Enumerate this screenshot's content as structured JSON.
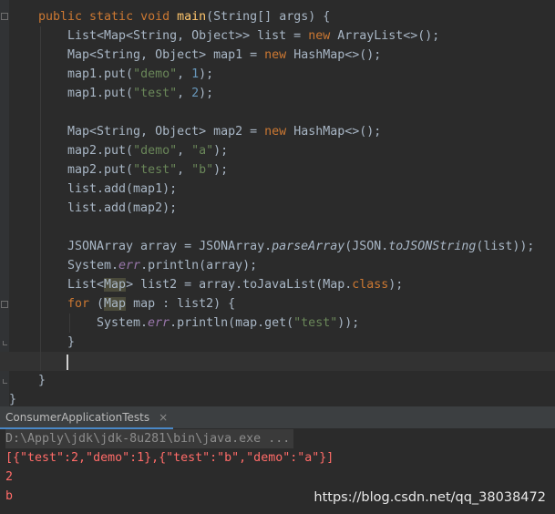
{
  "editor": {
    "lines": [
      {
        "indent": 42,
        "tokens": [
          {
            "c": "kw",
            "t": "public static void "
          },
          {
            "c": "fn",
            "t": "main"
          },
          {
            "c": "",
            "t": "(String[] args) {"
          }
        ]
      },
      {
        "indent": 74,
        "tokens": [
          {
            "c": "",
            "t": "List<Map<String, Object>> list = "
          },
          {
            "c": "kw",
            "t": "new "
          },
          {
            "c": "",
            "t": "ArrayList<>();"
          }
        ]
      },
      {
        "indent": 74,
        "tokens": [
          {
            "c": "",
            "t": "Map<String, Object> map1 = "
          },
          {
            "c": "kw",
            "t": "new "
          },
          {
            "c": "",
            "t": "HashMap<>();"
          }
        ]
      },
      {
        "indent": 74,
        "tokens": [
          {
            "c": "",
            "t": "map1.put("
          },
          {
            "c": "str",
            "t": "\"demo\""
          },
          {
            "c": "",
            "t": ", "
          },
          {
            "c": "num",
            "t": "1"
          },
          {
            "c": "",
            "t": ");"
          }
        ]
      },
      {
        "indent": 74,
        "tokens": [
          {
            "c": "",
            "t": "map1.put("
          },
          {
            "c": "str",
            "t": "\"test\""
          },
          {
            "c": "",
            "t": ", "
          },
          {
            "c": "num",
            "t": "2"
          },
          {
            "c": "",
            "t": ");"
          }
        ]
      },
      {
        "indent": 74,
        "tokens": []
      },
      {
        "indent": 74,
        "tokens": [
          {
            "c": "",
            "t": "Map<String, Object> map2 = "
          },
          {
            "c": "kw",
            "t": "new "
          },
          {
            "c": "",
            "t": "HashMap<>();"
          }
        ]
      },
      {
        "indent": 74,
        "tokens": [
          {
            "c": "",
            "t": "map2.put("
          },
          {
            "c": "str",
            "t": "\"demo\""
          },
          {
            "c": "",
            "t": ", "
          },
          {
            "c": "str",
            "t": "\"a\""
          },
          {
            "c": "",
            "t": ");"
          }
        ]
      },
      {
        "indent": 74,
        "tokens": [
          {
            "c": "",
            "t": "map2.put("
          },
          {
            "c": "str",
            "t": "\"test\""
          },
          {
            "c": "",
            "t": ", "
          },
          {
            "c": "str",
            "t": "\"b\""
          },
          {
            "c": "",
            "t": ");"
          }
        ]
      },
      {
        "indent": 74,
        "tokens": [
          {
            "c": "",
            "t": "list.add(map1);"
          }
        ]
      },
      {
        "indent": 74,
        "tokens": [
          {
            "c": "",
            "t": "list.add(map2);"
          }
        ]
      },
      {
        "indent": 74,
        "tokens": []
      },
      {
        "indent": 74,
        "tokens": [
          {
            "c": "",
            "t": "JSONArray array = JSONArray."
          },
          {
            "c": "it",
            "t": "parseArray"
          },
          {
            "c": "",
            "t": "(JSON."
          },
          {
            "c": "it",
            "t": "toJSONString"
          },
          {
            "c": "",
            "t": "(list));"
          }
        ]
      },
      {
        "indent": 74,
        "tokens": [
          {
            "c": "",
            "t": "System."
          },
          {
            "c": "field",
            "t": "err"
          },
          {
            "c": "",
            "t": ".println(array);"
          }
        ]
      },
      {
        "indent": 74,
        "tokens": [
          {
            "c": "",
            "t": "List<"
          },
          {
            "c": "hl",
            "t": "Map"
          },
          {
            "c": "",
            "t": "> list2 = array.toJavaList(Map."
          },
          {
            "c": "kw",
            "t": "class"
          },
          {
            "c": "",
            "t": ");"
          }
        ]
      },
      {
        "indent": 74,
        "tokens": [
          {
            "c": "kw",
            "t": "for "
          },
          {
            "c": "",
            "t": "("
          },
          {
            "c": "hl",
            "t": "Map"
          },
          {
            "c": "",
            "t": " map : list2) {"
          }
        ]
      },
      {
        "indent": 106,
        "tokens": [
          {
            "c": "",
            "t": "System."
          },
          {
            "c": "field",
            "t": "err"
          },
          {
            "c": "",
            "t": ".println(map.get("
          },
          {
            "c": "str",
            "t": "\"test\""
          },
          {
            "c": "",
            "t": "));"
          }
        ]
      },
      {
        "indent": 74,
        "tokens": [
          {
            "c": "",
            "t": "}"
          }
        ]
      },
      {
        "indent": 74,
        "tokens": [],
        "current": true
      },
      {
        "indent": 42,
        "tokens": [
          {
            "c": "",
            "t": "}"
          }
        ]
      },
      {
        "indent": 10,
        "tokens": [
          {
            "c": "",
            "t": "}"
          }
        ]
      }
    ]
  },
  "run_panel": {
    "tab_label": "ConsumerApplicationTests",
    "tab_close": "×",
    "command": "D:\\Apply\\jdk\\jdk-8u281\\bin\\java.exe ...",
    "output": [
      "[{\"test\":2,\"demo\":1},{\"test\":\"b\",\"demo\":\"a\"}]",
      "2",
      "b"
    ]
  },
  "watermark": "https://blog.csdn.net/qq_38038472"
}
